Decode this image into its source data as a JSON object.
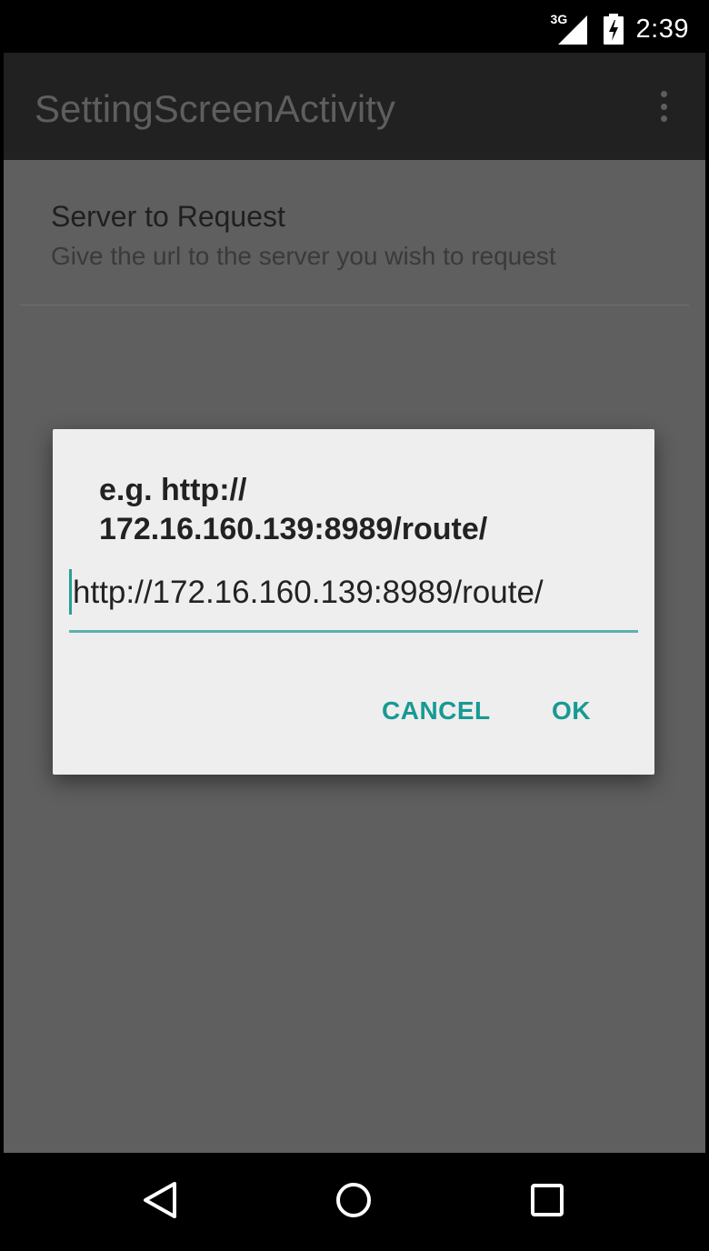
{
  "status_bar": {
    "network": "3G",
    "time": "2:39",
    "icons": [
      "signal-icon",
      "battery-charging-icon"
    ]
  },
  "app_bar": {
    "title": "SettingScreenActivity",
    "overflow_icon": "more-vert-icon"
  },
  "preference": {
    "title": "Server to Request",
    "summary": "Give the url to the server you wish to request"
  },
  "dialog": {
    "message": "e.g. http://\n172.16.160.139:8989/route/",
    "input_value": "http://172.16.160.139:8989/route/",
    "cancel_label": "CANCEL",
    "ok_label": "OK",
    "accent_color": "#179a93"
  },
  "nav_bar": {
    "icons": [
      "back-icon",
      "home-icon",
      "recents-icon"
    ]
  }
}
